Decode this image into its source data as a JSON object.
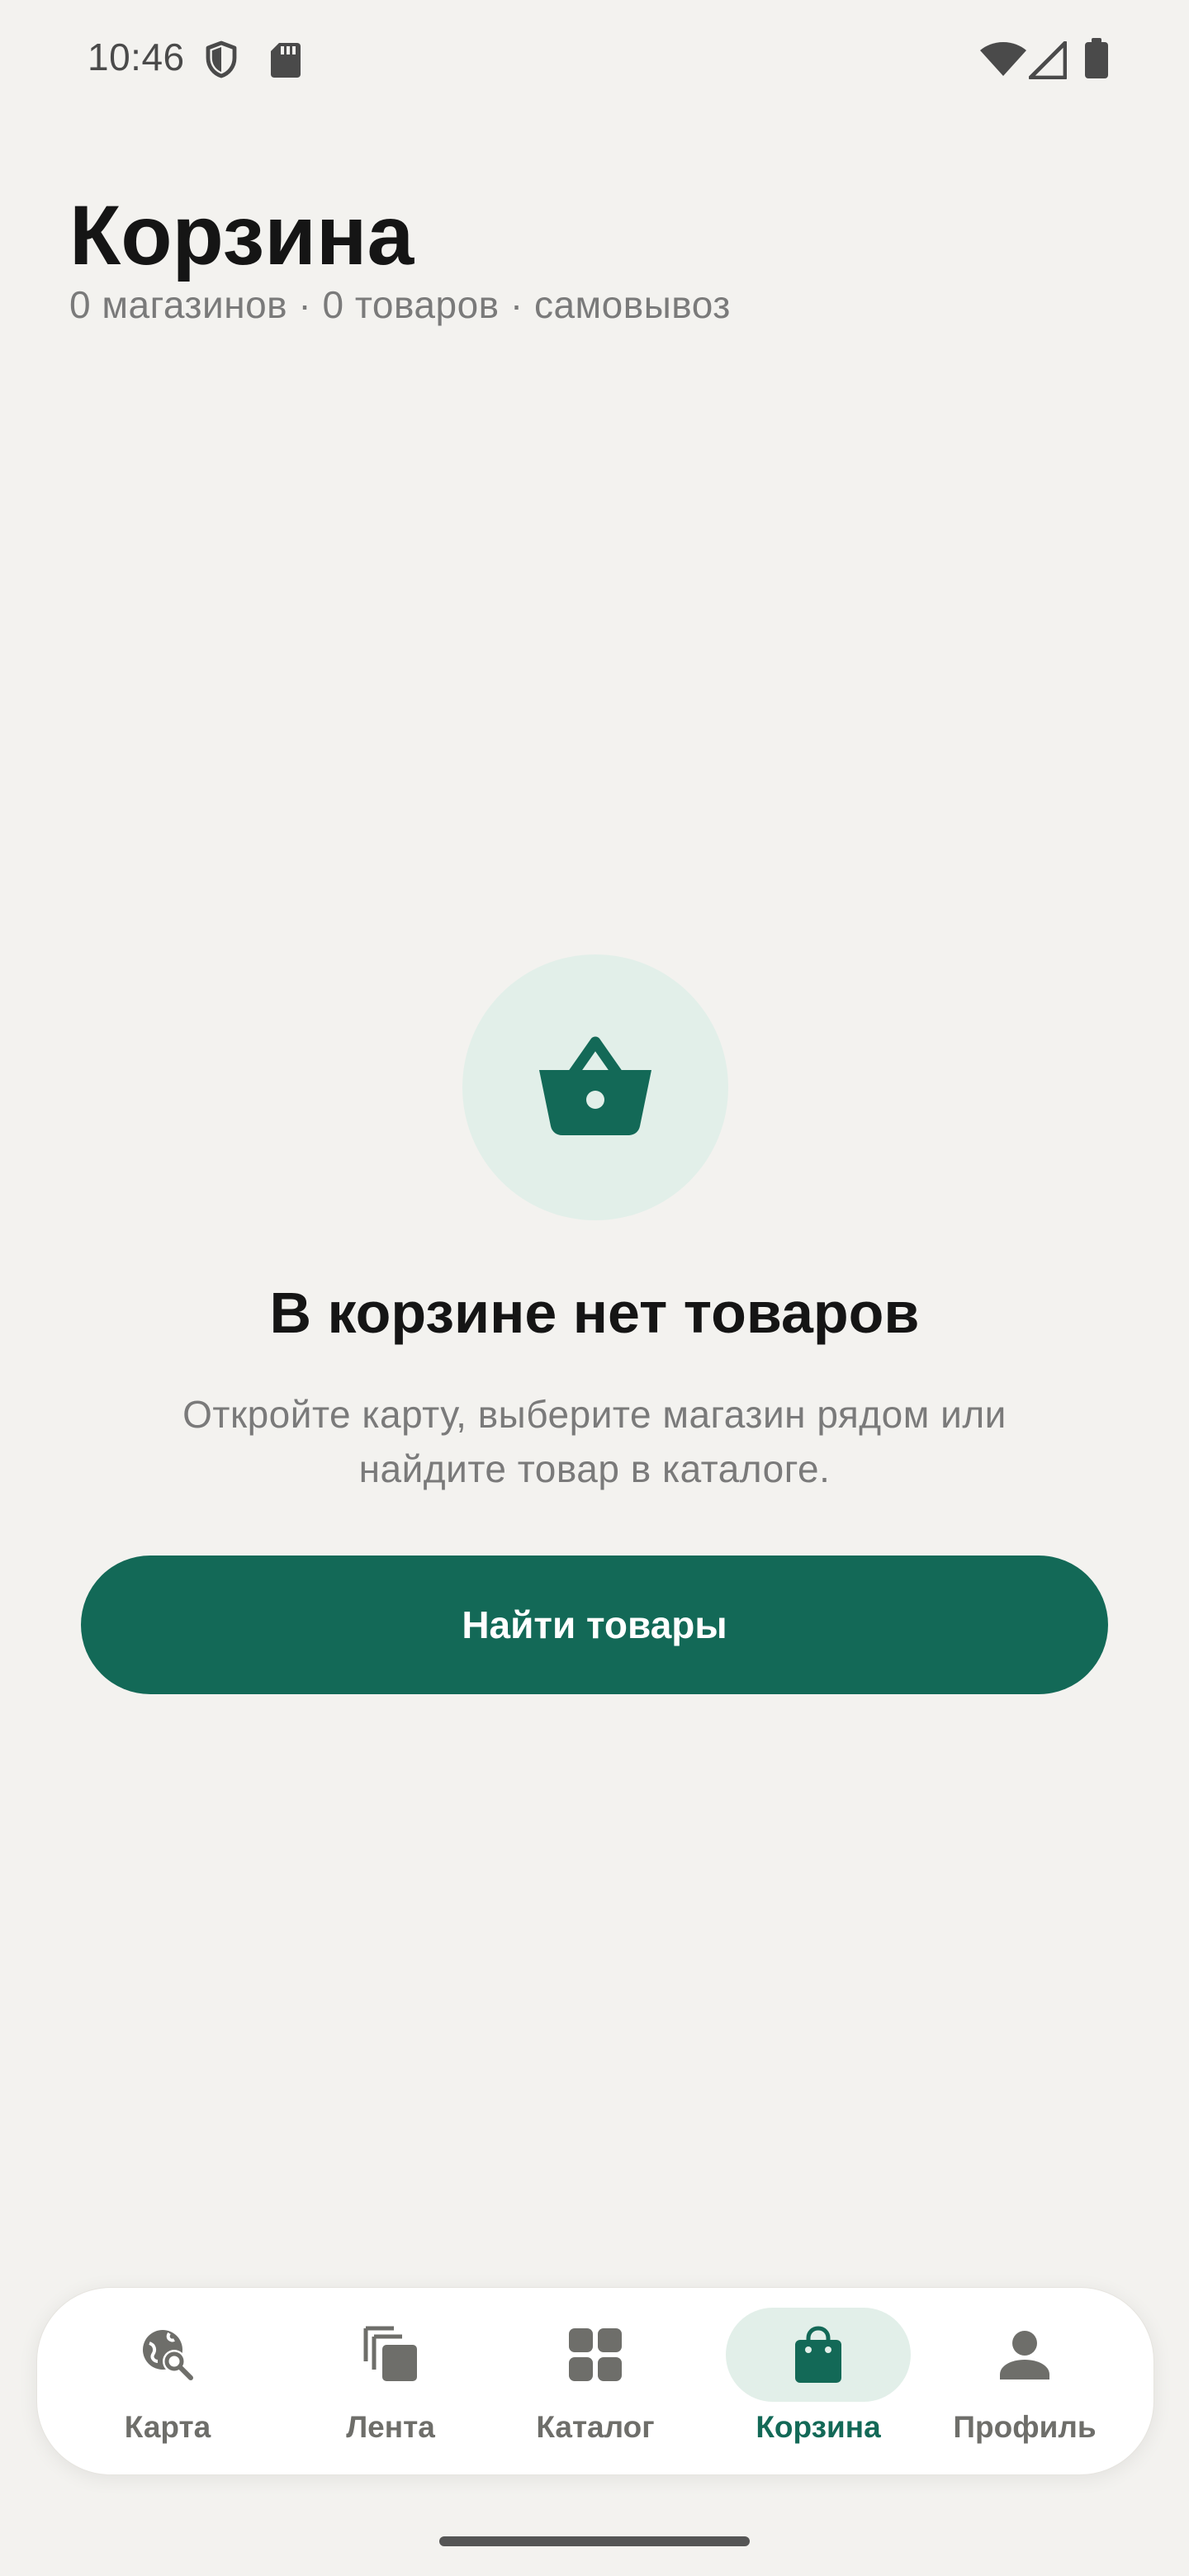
{
  "status_bar": {
    "time": "10:46"
  },
  "header": {
    "title": "Корзина",
    "subtitle": "0 магазинов · 0 товаров · самовывоз"
  },
  "empty_state": {
    "icon": "basket-icon",
    "title": "В корзине нет товаров",
    "text": "Откройте карту, выберите магазин рядом или найдите товар в каталоге.",
    "button_label": "Найти товары"
  },
  "bottom_nav": {
    "items": [
      {
        "label": "Карта",
        "icon": "map-search-icon",
        "active": false
      },
      {
        "label": "Лента",
        "icon": "feed-icon",
        "active": false
      },
      {
        "label": "Каталог",
        "icon": "catalog-grid-icon",
        "active": false
      },
      {
        "label": "Корзина",
        "icon": "cart-bag-icon",
        "active": true
      },
      {
        "label": "Профиль",
        "icon": "profile-icon",
        "active": false
      }
    ]
  },
  "colors": {
    "background": "#f3f2ef",
    "accent": "#136957",
    "accent_light": "#e2efe9",
    "text_primary": "#151515",
    "text_secondary": "#7a7a7a",
    "nav_inactive": "#6e6e6a"
  }
}
